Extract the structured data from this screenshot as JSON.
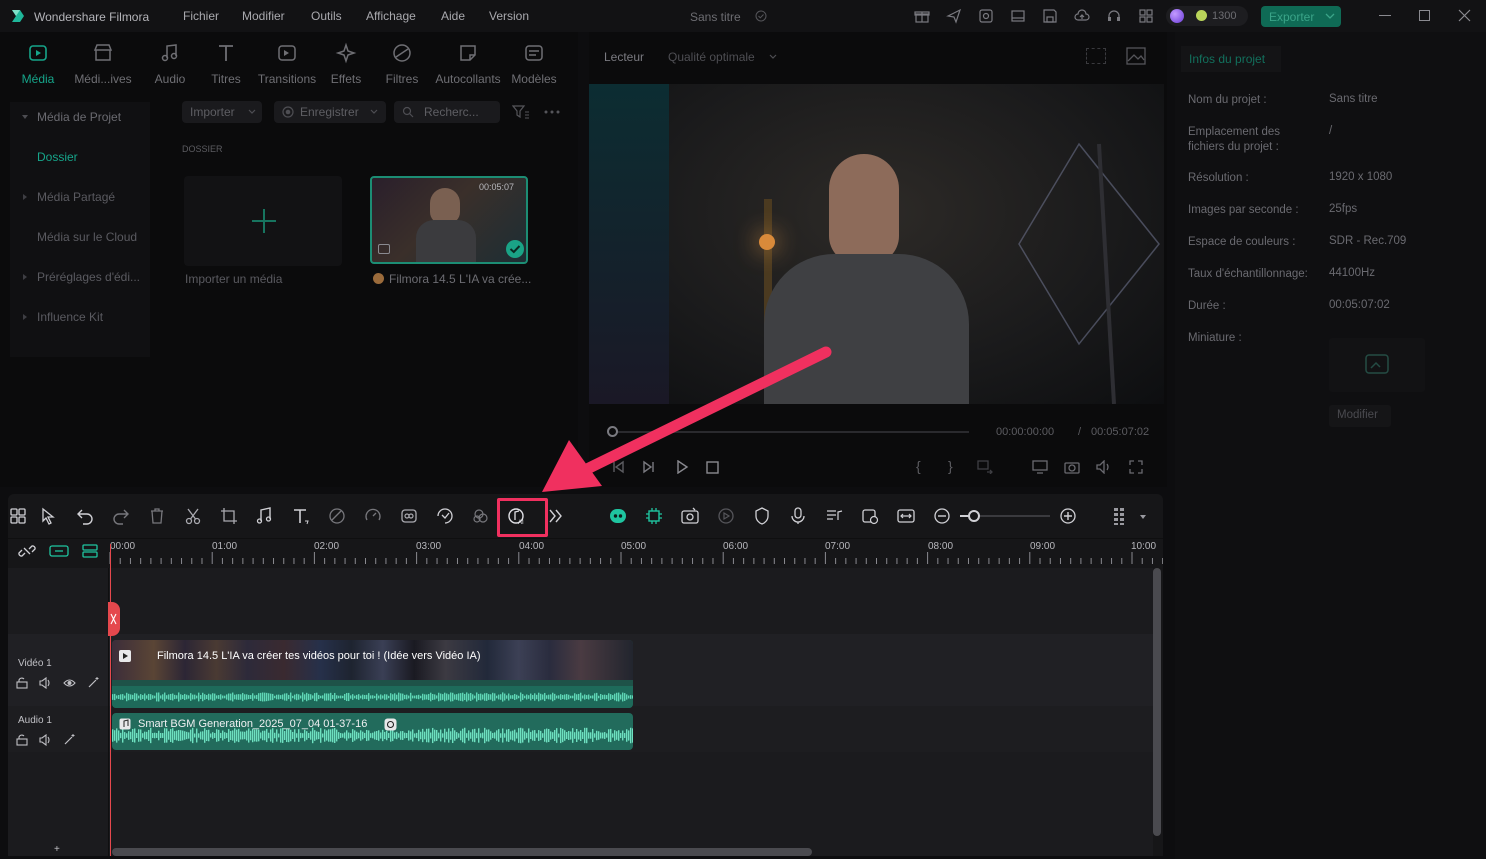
{
  "app": {
    "name": "Wondershare Filmora",
    "menu": [
      "Fichier",
      "Modifier",
      "Outils",
      "Affichage",
      "Aide",
      "Version"
    ],
    "document_title": "Sans titre",
    "credits": "1300",
    "export_label": "Exporter"
  },
  "media_tabs": [
    "Média",
    "Médi...ives",
    "Audio",
    "Titres",
    "Transitions",
    "Effets",
    "Filtres",
    "Autocollants",
    "Modèles"
  ],
  "sidebar": {
    "items": [
      "Média de Projet",
      "Dossier",
      "Média Partagé",
      "Média sur le Cloud",
      "Préréglages d'édi...",
      "Influence Kit"
    ]
  },
  "library": {
    "import_label": "Importer",
    "record_label": "Enregistrer",
    "search_placeholder": "Recherc...",
    "folder_header": "DOSSIER",
    "import_media_label": "Importer un média",
    "clip_name": "Filmora 14.5  L'IA va crée...",
    "clip_duration": "00:05:07"
  },
  "player": {
    "tab_label": "Lecteur",
    "quality": "Qualité optimale",
    "current_time": "00:00:00:00",
    "separator": "/",
    "total_time": "00:05:07:02"
  },
  "project_info": {
    "tab_label": "Infos du projet",
    "rows": [
      {
        "label": "Nom du projet :",
        "value": "Sans titre"
      },
      {
        "label": "Emplacement des fichiers du projet :",
        "value": "/"
      },
      {
        "label": "Résolution :",
        "value": "1920 x 1080"
      },
      {
        "label": "Images par seconde :",
        "value": "25fps"
      },
      {
        "label": "Espace de couleurs :",
        "value": "SDR - Rec.709"
      },
      {
        "label": "Taux d'échantillonnage:",
        "value": "44100Hz"
      },
      {
        "label": "Durée :",
        "value": "00:05:07:02"
      },
      {
        "label": "Miniature :",
        "value": ""
      }
    ],
    "modify_label": "Modifier"
  },
  "timeline": {
    "ruler": [
      "00:00",
      "01:00",
      "02:00",
      "03:00",
      "04:00",
      "05:00",
      "06:00",
      "07:00",
      "08:00",
      "09:00",
      "10:00"
    ],
    "tracks": [
      {
        "label": "Vidéo 1",
        "clip_title": "Filmora 14.5  L'IA va créer tes vidéos pour toi ! (Idée vers Vidéo IA)"
      },
      {
        "label": "Audio 1",
        "clip_title": "Smart BGM Generation_2025_07_04 01-37-16"
      }
    ]
  },
  "colors": {
    "accent": "#16a58a",
    "highlight": "#f0305f",
    "clip_audio": "#46c3a0"
  }
}
